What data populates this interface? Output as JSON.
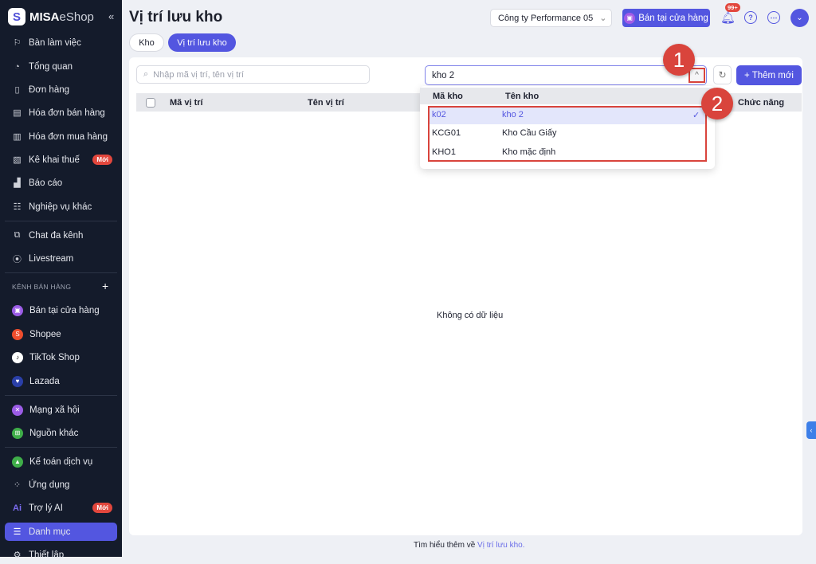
{
  "brand": {
    "logo_main": "MISA",
    "logo_sub": "eShop"
  },
  "sidebar": {
    "items": [
      {
        "label": "Bàn làm việc",
        "icon": "desk-icon"
      },
      {
        "label": "Tổng quan",
        "icon": "dashboard-icon"
      },
      {
        "label": "Đơn hàng",
        "icon": "order-icon"
      },
      {
        "label": "Hóa đơn bán hàng",
        "icon": "invoice-icon"
      },
      {
        "label": "Hóa đơn mua hàng",
        "icon": "receipt-icon"
      },
      {
        "label": "Kê khai thuế",
        "icon": "tax-icon",
        "badge": "Mới"
      },
      {
        "label": "Báo cáo",
        "icon": "chart-icon"
      },
      {
        "label": "Nghiệp vụ khác",
        "icon": "list-icon"
      },
      {
        "label": "Chat đa kênh",
        "icon": "chat-icon"
      },
      {
        "label": "Livestream",
        "icon": "livestream-icon"
      }
    ],
    "channels_header": "KÊNH BÁN HÀNG",
    "channels": [
      {
        "label": "Bán tại cửa hàng",
        "color": "#9b5ce6"
      },
      {
        "label": "Shopee",
        "color": "#ee4d2d"
      },
      {
        "label": "TikTok Shop",
        "color": "#ffffff"
      },
      {
        "label": "Lazada",
        "color": "#2a3fa8"
      }
    ],
    "social": [
      {
        "label": "Mạng xã hội",
        "color": "#9b5ce6"
      },
      {
        "label": "Nguồn khác",
        "color": "#3fae49"
      }
    ],
    "bottom": [
      {
        "label": "Kế toán dịch vụ"
      },
      {
        "label": "Ứng dụng"
      },
      {
        "label": "Trợ lý AI",
        "badge": "Mới"
      },
      {
        "label": "Danh mục"
      },
      {
        "label": "Thiết lập"
      }
    ]
  },
  "header": {
    "title": "Vị trí lưu kho",
    "company": "Công ty Performance 05",
    "pos_button": "Bán tại cửa hàng",
    "notif_badge": "99+"
  },
  "tabs": [
    "Kho",
    "Vị trí lưu kho"
  ],
  "toolbar": {
    "search_placeholder": "Nhập mã vị trí, tên vị trí",
    "warehouse_value": "kho 2",
    "add_button": "+ Thêm mới"
  },
  "table": {
    "columns": [
      "Mã vị trí",
      "Tên vị trí",
      "Chức năng"
    ],
    "empty": "Không có dữ liệu"
  },
  "dropdown": {
    "columns": [
      "Mã kho",
      "Tên kho"
    ],
    "rows": [
      {
        "code": "k02",
        "name": "kho 2",
        "selected": true
      },
      {
        "code": "KCG01",
        "name": "Kho Cầu Giấy"
      },
      {
        "code": "KHO1",
        "name": "Kho mặc định"
      }
    ]
  },
  "annotations": [
    "1",
    "2"
  ],
  "footer": {
    "text": "Tìm hiểu thêm về ",
    "link": "Vị trí lưu kho."
  },
  "colors": {
    "accent": "#5356e0",
    "sidebar": "#141b2b",
    "annotation": "#d9443c"
  }
}
